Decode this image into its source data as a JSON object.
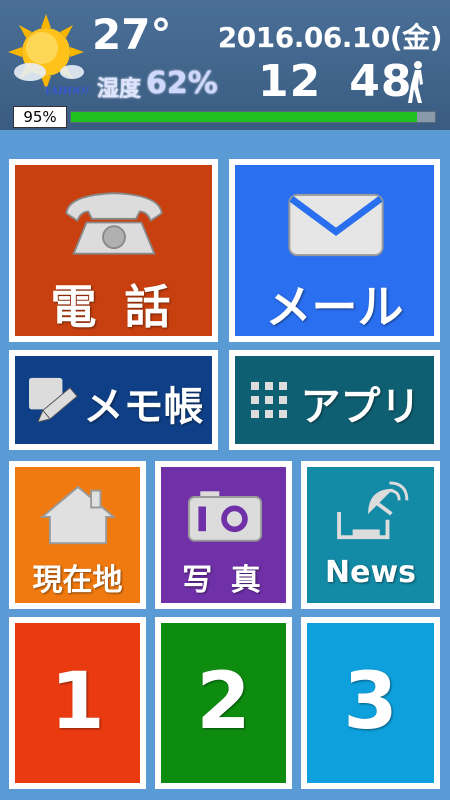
{
  "weather": {
    "temperature": "27°",
    "humidity_label": "湿度",
    "humidity_value": "62%",
    "provider": "YAHOO!",
    "icon": "sun-icon"
  },
  "datetime": {
    "date": "2016.06.10(金)",
    "hour": "12",
    "minute": "48"
  },
  "battery": {
    "label": "95%",
    "level_percent": 95,
    "bar_color": "#20c020"
  },
  "tiles": [
    {
      "id": "phone",
      "label": "電 話",
      "icon": "phone-icon",
      "color": "#c8400f"
    },
    {
      "id": "mail",
      "label": "メール",
      "icon": "envelope-icon",
      "color": "#2a6fef"
    },
    {
      "id": "memo",
      "label": "メモ帳",
      "icon": "memo-pencil-icon",
      "color": "#0f3f86"
    },
    {
      "id": "apps",
      "label": "アプリ",
      "icon": "grid-icon",
      "color": "#0f5f72"
    },
    {
      "id": "location",
      "label": "現在地",
      "icon": "home-icon",
      "color": "#f07a10"
    },
    {
      "id": "photo",
      "label": "写 真",
      "icon": "camera-icon",
      "color": "#7030a8"
    },
    {
      "id": "news",
      "label": "News",
      "icon": "satellite-dish-icon",
      "color": "#138aa6"
    },
    {
      "id": "speed1",
      "label": "1",
      "color": "#ea3a10"
    },
    {
      "id": "speed2",
      "label": "2",
      "color": "#0e8c10"
    },
    {
      "id": "speed3",
      "label": "3",
      "color": "#0ea0dc"
    }
  ]
}
